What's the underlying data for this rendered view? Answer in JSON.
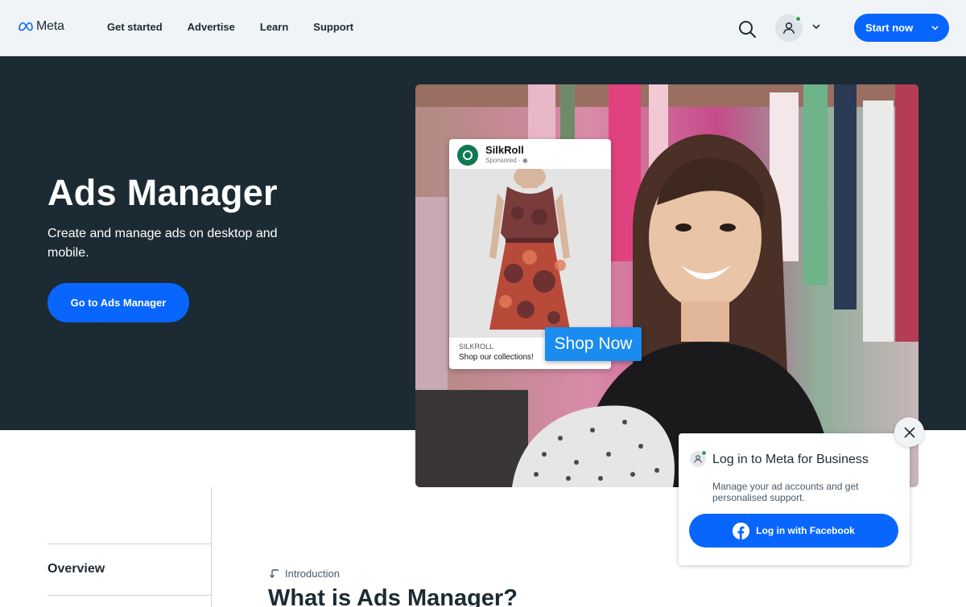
{
  "header": {
    "logo_text": "Meta",
    "nav": [
      "Get started",
      "Advertise",
      "Learn",
      "Support"
    ],
    "start_label": "Start now"
  },
  "hero": {
    "title": "Ads Manager",
    "subtitle": "Create and manage ads on desktop and mobile.",
    "cta_label": "Go to Ads Manager"
  },
  "ad_card": {
    "brand": "SilkRoll",
    "sponsored": "Sponsored · ",
    "store": "SILKROLL",
    "tagline": "Shop our collections!",
    "shop_label": "Shop Now"
  },
  "content": {
    "sidebar_overview": "Overview",
    "intro_label": "Introduction",
    "section_title": "What is Ads Manager?"
  },
  "login_popup": {
    "title": "Log in to Meta for Business",
    "text": "Manage your ad accounts and get personalised support.",
    "button_label": "Log in with Facebook"
  },
  "colors": {
    "brand_blue": "#0866ff",
    "hero_bg": "#1c2b33",
    "header_bg": "#f1f4f7",
    "online_green": "#31a24c"
  },
  "icons": [
    "meta-logo-icon",
    "search-icon",
    "user-icon",
    "chevron-down-icon",
    "close-icon",
    "facebook-icon",
    "intro-arrow-icon"
  ]
}
